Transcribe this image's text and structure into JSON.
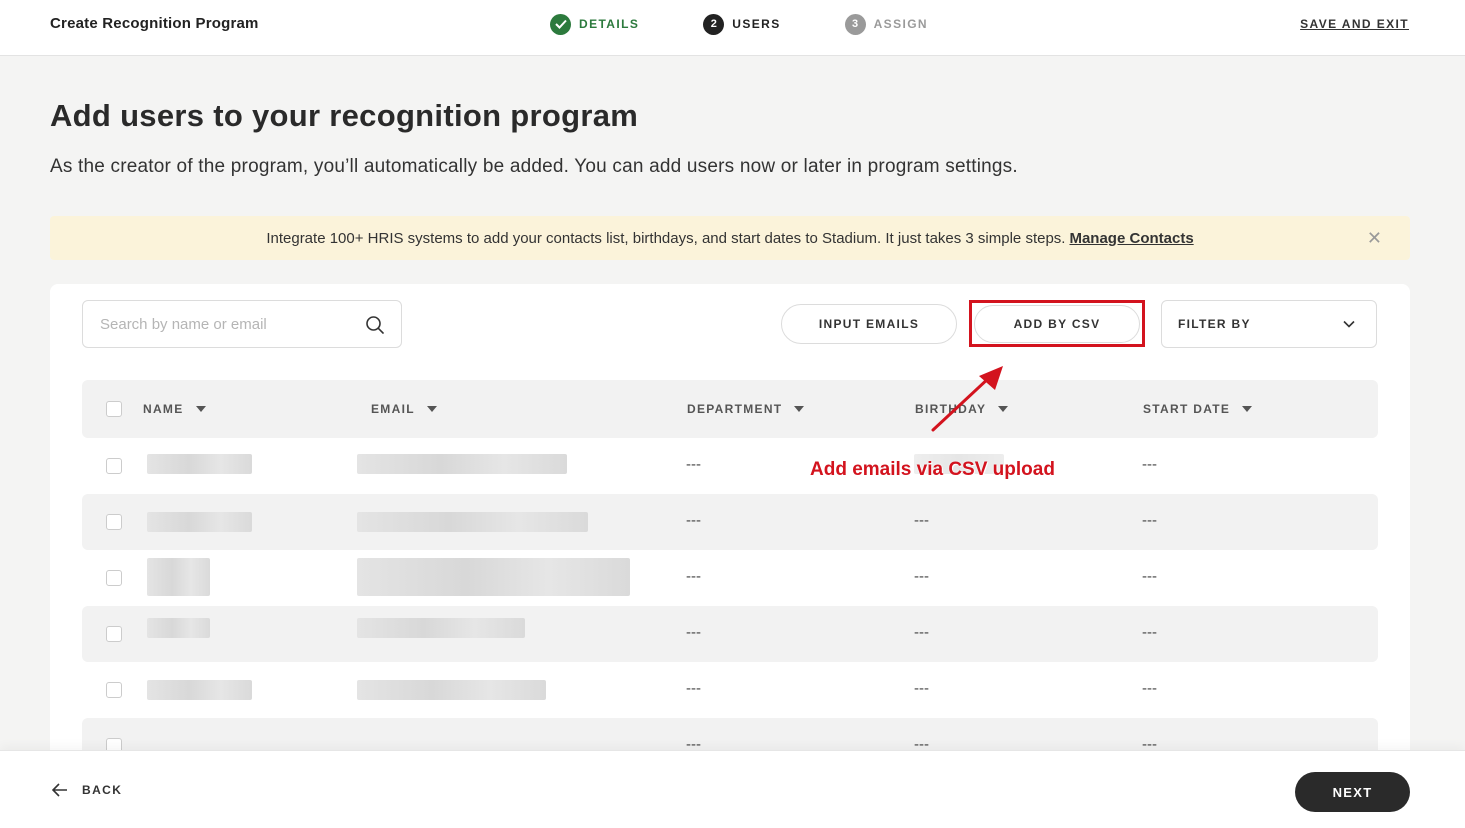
{
  "header": {
    "title": "Create Recognition Program",
    "steps": [
      {
        "number": "",
        "label": "DETAILS",
        "state": "done"
      },
      {
        "number": "2",
        "label": "USERS",
        "state": "current"
      },
      {
        "number": "3",
        "label": "ASSIGN",
        "state": "todo"
      }
    ],
    "save_exit": "SAVE AND EXIT"
  },
  "page": {
    "title": "Add users to your recognition program",
    "subtitle": "As the creator of the program, you’ll automatically be added. You can add users now or later in program settings."
  },
  "banner": {
    "text": "Integrate 100+ HRIS systems to add your contacts list, birthdays, and start dates to Stadium. It just takes 3 simple steps.",
    "link": "Manage Contacts",
    "close_glyph": "✕"
  },
  "toolbar": {
    "search_placeholder": "Search by name or email",
    "input_emails": "INPUT EMAILS",
    "add_by_csv": "ADD BY CSV",
    "filter_label": "FILTER BY"
  },
  "table": {
    "columns": [
      "NAME",
      "EMAIL",
      "DEPARTMENT",
      "BIRTHDAY",
      "START DATE"
    ],
    "rows": [
      {
        "department": "---",
        "birthday": "",
        "start_date": "---"
      },
      {
        "department": "---",
        "birthday": "---",
        "start_date": "---"
      },
      {
        "department": "---",
        "birthday": "---",
        "start_date": "---"
      },
      {
        "department": "---",
        "birthday": "---",
        "start_date": "---"
      },
      {
        "department": "---",
        "birthday": "---",
        "start_date": "---"
      },
      {
        "department": "---",
        "birthday": "---",
        "start_date": "---"
      }
    ]
  },
  "annotation": {
    "text": "Add emails via CSV upload",
    "color": "#d3131e"
  },
  "footer": {
    "back": "BACK",
    "next": "NEXT"
  },
  "colors": {
    "done_green": "#2c7a3d",
    "banner_bg": "#fbf3da",
    "highlight_red": "#d3131e",
    "primary_dark": "#2a2a2a"
  }
}
